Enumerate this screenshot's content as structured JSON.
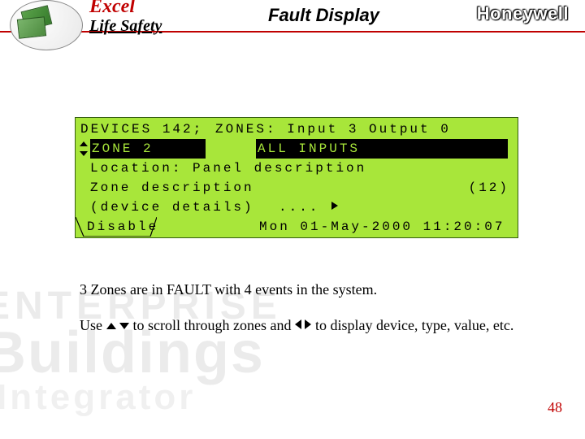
{
  "header": {
    "brand1": "Excel",
    "brand2": "Life Safety",
    "slide_title": "Fault Display",
    "company": "Honeywell"
  },
  "watermark": {
    "line1": "ENTERPRISE",
    "line2": "Buildings",
    "line3": "Integrator"
  },
  "lcd": {
    "row1": {
      "left": "DEVICES 142;",
      "right": "ZONES: Input 3 Output 0"
    },
    "row2": {
      "zone": "ZONE 2",
      "inputs": "ALL INPUTS"
    },
    "row3": "Location: Panel description",
    "row4_left": "Zone description",
    "row4_right": "(12)",
    "row5_left": "(device details)",
    "row5_dots": "....",
    "row6_left": "Disable",
    "row6_right": "Mon 01-May-2000 11:20:07"
  },
  "body": {
    "line1": "3 Zones are in FAULT with 4 events in the system.",
    "line2a": "Use ",
    "line2b": " to scroll through zones and ",
    "line2c": " to display device, type, value, etc."
  },
  "page_number": "48"
}
